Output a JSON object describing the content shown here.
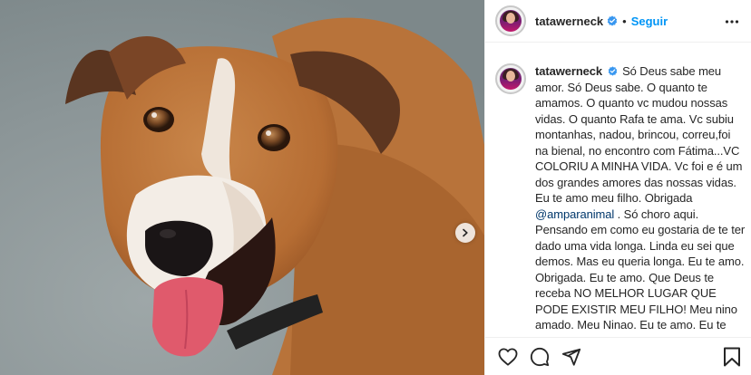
{
  "post": {
    "username": "tatawerneck",
    "separator": "•",
    "follow_label": "Seguir",
    "caption": {
      "username": "tatawerneck",
      "part1": "Só Deus sabe meu amor. Só Deus sabe. O quanto te amamos. O quanto vc mudou nossas vidas. O quanto Rafa te ama. Vc subiu montanhas, nadou, brincou, correu,foi na bienal, no encontro com Fátima...VC COLORIU A MINHA VIDA. Vc foi e é um dos grandes amores das nossas vidas. Eu te amo meu filho. Obrigada ",
      "mention": "@amparanimal",
      "part2": " . Só choro aqui. Pensando em como eu gostaria de te ter dado uma vida longa. Linda eu sei que demos. Mas eu queria longa. Eu te amo. Obrigada. Eu te amo. Que Deus te receba NO MELHOR LUGAR QUE PODE EXISTIR MEU FILHO! Meu nino amado. Meu Ninao. Eu te amo. Eu te amo. Eu te amo. Eu te amo. Eu TE AMOOOOOO ! Por favor ADOTEM!"
    }
  },
  "icons": {
    "verified": "verified-badge-icon",
    "more": "more-options-icon",
    "next": "chevron-right-icon",
    "like": "heart-icon",
    "comment": "comment-icon",
    "share": "paper-plane-icon",
    "save": "bookmark-icon"
  },
  "colors": {
    "link_blue": "#0095f6",
    "mention": "#00376b",
    "text": "#262626"
  }
}
